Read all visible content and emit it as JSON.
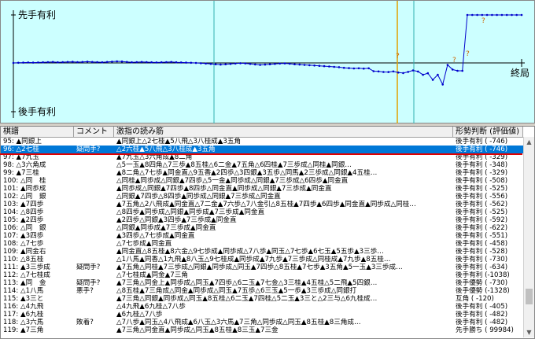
{
  "graph": {
    "label_top": "先手有利",
    "label_bottom": "後手有利",
    "label_end": "終局",
    "markers": [
      "?",
      "?",
      "?",
      "?"
    ],
    "colors": {
      "background": "#ccffff",
      "line": "#0000cc",
      "marker": "#cc6600",
      "cursor": "#e0a000"
    }
  },
  "list": {
    "headers": [
      "棋譜",
      "コメント",
      "激指の読み筋",
      "形勢判断 (評価値)"
    ],
    "rows": [
      {
        "move": "95: ▲同銀上",
        "comment": "",
        "line": "▲同銀上△2七桂▲5八飛△3八桂成▲3五角",
        "eval": "後手有利 ( -746)",
        "selected": false
      },
      {
        "move": "96: △2七桂",
        "comment": "疑問手?",
        "line": "△2六桂▲5八飛△3八桂成▲3五角",
        "eval": "後手有利 ( -746)",
        "selected": true
      },
      {
        "move": "97: ▲7九玉",
        "comment": "",
        "line": "▲7九玉△3六角成▲8二角",
        "eval": "後手有利 ( -329)",
        "selected": false
      },
      {
        "move": "98: △3六角成",
        "comment": "",
        "line": "△5一玉▲8四角△7三歩▲8五桂△6二金▲7五角△6四桂▲7三歩成△同桂▲同銀…",
        "eval": "後手有利 ( -348)",
        "selected": false
      },
      {
        "move": "99: ▲7三桂",
        "comment": "",
        "line": "▲8二角△7七歩▲同金直△9五香▲2四歩△3四銀▲3五歩△同馬▲2三歩成△同銀▲4五桂…",
        "eval": "後手有利 ( -329)",
        "selected": false
      },
      {
        "move": "100: △同　桂",
        "comment": "",
        "line": "△同桂▲同歩成△同銀▲7四歩△5一金▲同歩成△同銀▲7三歩成△6四歩▲同金直",
        "eval": "後手有利 ( -508)",
        "selected": false
      },
      {
        "move": "101: ▲同歩成",
        "comment": "",
        "line": "▲同歩成△同銀▲7四歩▲8四歩△同金直▲同歩成△同銀▲7三歩成▲同金直",
        "eval": "後手有利 ( -525)",
        "selected": false
      },
      {
        "move": "102: △同　銀",
        "comment": "",
        "line": "△同銀▲7四歩△8四歩▲同歩成△同銀▲7三歩成△同金直",
        "eval": "後手有利 ( -556)",
        "selected": false
      },
      {
        "move": "103: ▲7四歩",
        "comment": "",
        "line": "▲7五角△2八飛成▲同金直△7二金▲7六歩△7八金引△8五桂▲7四歩▲6四歩▲同金直▲同歩成△同桂…",
        "eval": "後手有利 ( -562)",
        "selected": false
      },
      {
        "move": "104: △8四歩",
        "comment": "",
        "line": "△8四歩▲同歩成△同銀▲同歩成▲7三歩成▲同金直",
        "eval": "後手有利 ( -525)",
        "selected": false
      },
      {
        "move": "105: ▲2四歩",
        "comment": "",
        "line": "▲2四歩△同銀▲3四歩▲7三歩成▲同金直",
        "eval": "後手有利 ( -592)",
        "selected": false
      },
      {
        "move": "106: △同　銀",
        "comment": "",
        "line": "△同銀▲同歩成▲7三歩成▲同金直",
        "eval": "後手有利 ( -622)",
        "selected": false
      },
      {
        "move": "107: ▲3四歩",
        "comment": "",
        "line": "▲3四歩△7七歩成▲同金直",
        "eval": "後手有利 ( -551)",
        "selected": false
      },
      {
        "move": "108: △7七歩",
        "comment": "",
        "line": "△7七歩成▲同金直",
        "eval": "後手有利 ( -458)",
        "selected": false
      },
      {
        "move": "109: ▲同金右",
        "comment": "",
        "line": "▲同金直△8五桂▲8六金△9七歩成▲同歩成△7八歩▲同玉△7七歩▲6七玉▲5五歩▲3三歩…",
        "eval": "後手有利 ( -528)",
        "selected": false
      },
      {
        "move": "110: △8五桂",
        "comment": "",
        "line": "△1八馬▲同香△1九飛▲8八玉△9七桂成▲同歩成▲7九歩▲7三歩成△同桂成▲7九歩▲8五桂…",
        "eval": "後手有利 ( -730)",
        "selected": false
      },
      {
        "move": "111: ▲3三歩成",
        "comment": "疑問手?",
        "line": "▲7五角△同桂▲7三歩成△同銀▲同歩成△同玉▲7四歩△8五桂▲7七歩▲3五角▲5一玉▲3三歩成…",
        "eval": "後手有利 ( -634)",
        "selected": false
      },
      {
        "move": "112: △7七桂成",
        "comment": "",
        "line": "△7七桂成▲同金▲7三角",
        "eval": "後手有利 (-1038)",
        "selected": false
      },
      {
        "move": "113: ▲同　金",
        "comment": "疑問手?",
        "line": "▲7三角△同金上▲同歩成△同玉▲7四歩△6二玉▲7七金△3三桂▲4五桂△5二飛▲5四銀…",
        "eval": "後手優勢 ( -730)",
        "selected": false
      },
      {
        "move": "114: △1八馬",
        "comment": "悪手?",
        "line": "△8五桂▲7三角成△同金▲同歩成△同玉▲7五歩△6三玉▲5一歩▲3三歩成△同銀打",
        "eval": "後手優勢 (-1328)",
        "selected": false
      },
      {
        "move": "115: ▲3三と",
        "comment": "",
        "line": "▲7三角△同銀▲同歩成△同玉▲8五桂△6二玉▲7四桂△5二玉▲3三と△2三与△6九桂成…",
        "eval": "互角 ( -120)",
        "selected": false
      },
      {
        "move": "116: △4九飛",
        "comment": "",
        "line": "△4九飛▲6九桂△7八歩",
        "eval": "後手有利 ( -405)",
        "selected": false
      },
      {
        "move": "117: ▲6九桂",
        "comment": "",
        "line": "▲6九桂△7八歩",
        "eval": "後手有利 ( -482)",
        "selected": false
      },
      {
        "move": "118: △3六馬",
        "comment": "敗着?",
        "line": "△7八歩▲同玉△4八飛成▲6八玉△3六馬▲7三角△同歩成△同玉▲8五桂▲8三角成…",
        "eval": "後手有利 ( -482)",
        "selected": false
      },
      {
        "move": "119: ▲7三角",
        "comment": "",
        "line": "▲7三角△同金直▲同歩成△同玉▲8五桂▲8三玉▲7三金",
        "eval": "先手勝ち ( 99984)",
        "selected": false
      }
    ]
  },
  "scrollbar": {
    "position": 0.86
  },
  "chart_data": {
    "type": "line",
    "title": "",
    "xlabel": "",
    "ylabel": "",
    "ylim": [
      -3000,
      3000
    ],
    "series": [
      {
        "name": "",
        "values": [
          0,
          10,
          20,
          30,
          20,
          30,
          40,
          50,
          60,
          40,
          50,
          60,
          70,
          50,
          60,
          80,
          60,
          50,
          40,
          60,
          80,
          100,
          90,
          60,
          40,
          50,
          60,
          50,
          40,
          30,
          40,
          50,
          60,
          40,
          30,
          20,
          10,
          0,
          -20,
          -40,
          -60,
          -80,
          -100,
          -80,
          -60,
          -40,
          -20,
          -30,
          -60,
          -90,
          -120,
          -100,
          -80,
          -60,
          -40,
          -30,
          -50,
          -80,
          -100,
          -120,
          -140,
          -160,
          -180,
          -200,
          -220,
          -240,
          -260,
          -300,
          -320,
          -340,
          -329,
          -348,
          -329,
          -508,
          -525,
          -556,
          -562,
          -525,
          -592,
          -622,
          -551,
          -458,
          -528,
          -730,
          -634,
          -1038,
          -730,
          -1328,
          -120,
          -405,
          -482,
          -482,
          3000,
          3000,
          3000,
          3000,
          3000,
          3000,
          3000,
          3000,
          3000,
          3000,
          3000,
          3000
        ]
      }
    ]
  }
}
